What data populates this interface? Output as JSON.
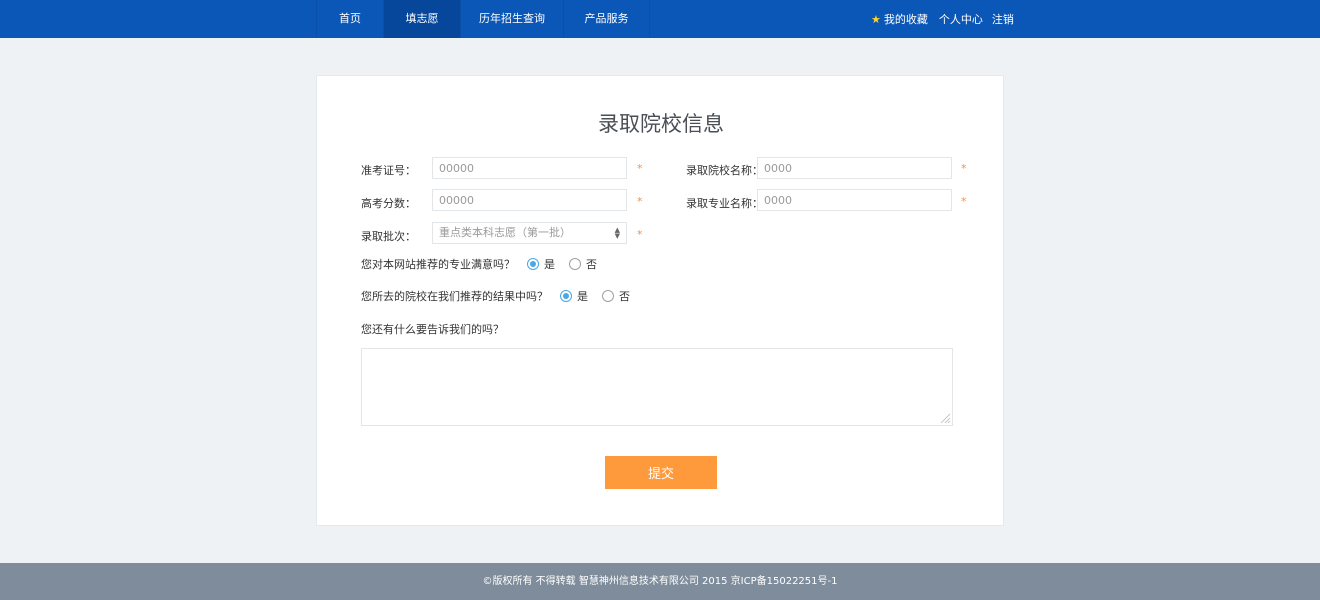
{
  "nav": {
    "items": [
      {
        "label": "首页",
        "active": false
      },
      {
        "label": "填志愿",
        "active": true
      },
      {
        "label": "历年招生查询",
        "active": false
      },
      {
        "label": "产品服务",
        "active": false
      }
    ]
  },
  "user": {
    "favorites": "我的收藏",
    "profile": "个人中心",
    "logout": "注销",
    "star_icon": "star-icon"
  },
  "form": {
    "title": "录取院校信息",
    "exam_id": {
      "label": "准考证号：",
      "placeholder": "00000"
    },
    "school_name": {
      "label": "录取院校名称：",
      "placeholder": "0000"
    },
    "score": {
      "label": "高考分数：",
      "placeholder": "00000"
    },
    "major_name": {
      "label": "录取专业名称：",
      "placeholder": "0000"
    },
    "batch": {
      "label": "录取批次：",
      "selected": "重点类本科志愿（第一批）"
    },
    "required_mark": "*",
    "q1": {
      "label": "您对本网站推荐的专业满意吗？",
      "yes": "是",
      "no": "否",
      "selected": "yes"
    },
    "q2": {
      "label": "您所去的院校在我们推荐的结果中吗？",
      "yes": "是",
      "no": "否",
      "selected": "yes"
    },
    "feedback": {
      "label": "您还有什么要告诉我们的吗？"
    },
    "submit": "提交"
  },
  "footer": {
    "text": "©版权所有 不得转载 智慧神州信息技术有限公司 2015 京ICP备15022251号-1"
  },
  "colors": {
    "nav_bg": "#0a57b8",
    "accent": "#ff9a3c",
    "radio": "#49a6e7",
    "footer_bg": "#7f8c9b"
  }
}
